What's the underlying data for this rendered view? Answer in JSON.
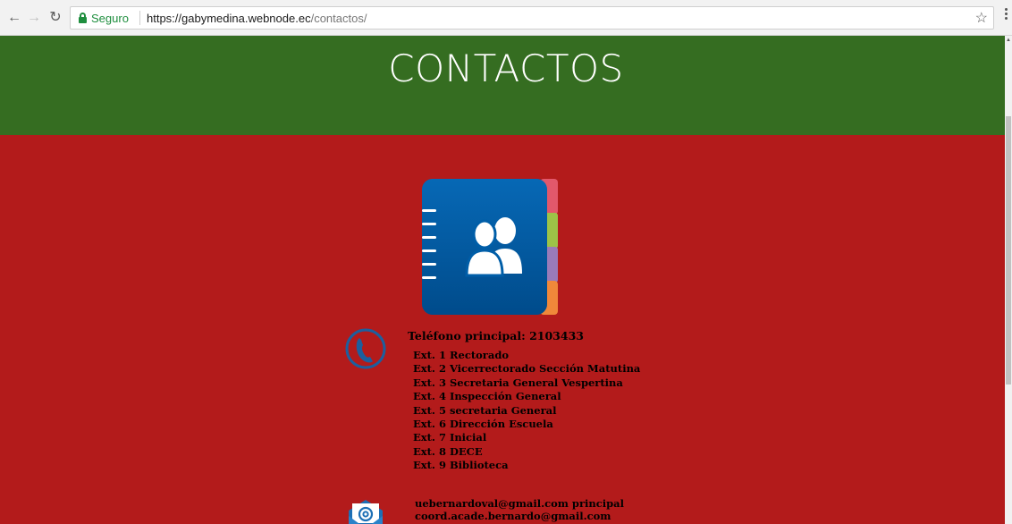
{
  "browser": {
    "secure_label": "Seguro",
    "url_host": "https://gabymedina.webnode.ec",
    "url_path": "/contactos/",
    "back_icon": "arrow-left-icon",
    "forward_icon": "arrow-right-icon",
    "reload_icon": "reload-icon",
    "bookmark_icon": "star-icon",
    "menu_icon": "kebab-menu-icon"
  },
  "header": {
    "title": "CONTACTOS"
  },
  "phone": {
    "main": "Teléfono principal: 2103433",
    "extensions": [
      "Ext. 1 Rectorado",
      "Ext. 2 Vicerrectorado Sección Matutina",
      "Ext. 3 Secretaria General Vespertina",
      "Ext. 4 Inspección General",
      "Ext. 5 secretaria General",
      "Ext. 6 Dirección Escuela",
      "Ext. 7 Inicial",
      "Ext. 8 DECE",
      "Ext. 9 Biblioteca"
    ]
  },
  "email": {
    "addresses": [
      "uebernardoval@gmail.com  principal",
      "coord.acade.bernardo@gmail.com"
    ]
  },
  "colors": {
    "header_green": "#356d21",
    "content_red": "#b31b1b",
    "secure_green": "#1e8e3e"
  }
}
